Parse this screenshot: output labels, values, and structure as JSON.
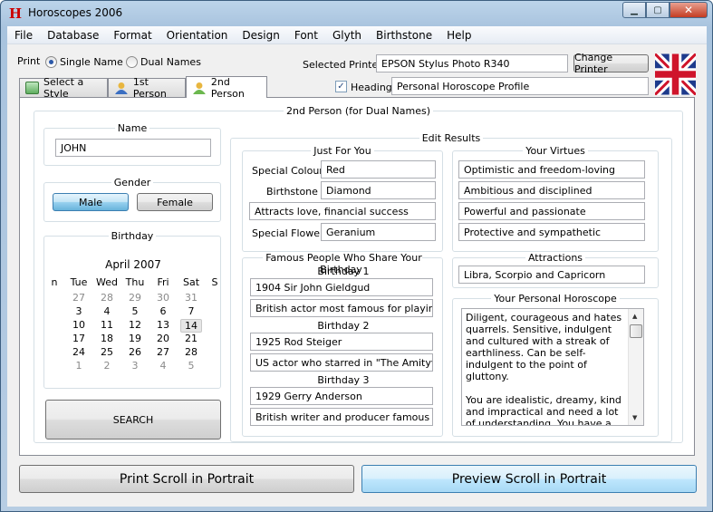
{
  "window": {
    "title": "Horoscopes 2006",
    "minimize": "▁",
    "maximize": "▢",
    "close": "✕"
  },
  "menu": [
    "File",
    "Database",
    "Format",
    "Orientation",
    "Design",
    "Font",
    "Glyth",
    "Birthstone",
    "Help"
  ],
  "print": {
    "label": "Print",
    "single": "Single Name",
    "dual": "Dual Names",
    "selected": "single"
  },
  "printer": {
    "label": "Selected Printer",
    "value": "EPSON Stylus Photo R340",
    "change_button": "Change Printer"
  },
  "heading": {
    "checked": true,
    "label": "Heading",
    "value": "Personal Horoscope Profile"
  },
  "tabs": [
    {
      "label": "Select a Style",
      "icon": "image-icon"
    },
    {
      "label": "1st Person",
      "icon": "person-icon"
    },
    {
      "label": "2nd Person",
      "icon": "person-icon"
    }
  ],
  "active_tab": 2,
  "panel_title": "2nd Person (for Dual Names)",
  "name": {
    "label": "Name",
    "value": "JOHN"
  },
  "gender": {
    "label": "Gender",
    "male": "Male",
    "female": "Female",
    "selected": "male"
  },
  "birthday": {
    "label": "Birthday",
    "month": "April 2007",
    "days": [
      "n",
      "Tue",
      "Wed",
      "Thu",
      "Fri",
      "Sat",
      "S"
    ],
    "weeks": [
      [
        "27",
        "28",
        "29",
        "30",
        "31"
      ],
      [
        "3",
        "4",
        "5",
        "6",
        "7"
      ],
      [
        "10",
        "11",
        "12",
        "13",
        "14"
      ],
      [
        "17",
        "18",
        "19",
        "20",
        "21"
      ],
      [
        "24",
        "25",
        "26",
        "27",
        "28"
      ],
      [
        "1",
        "2",
        "3",
        "4",
        "5"
      ]
    ],
    "selected": "14"
  },
  "search_button": "SEARCH",
  "edit_results": {
    "label": "Edit Results",
    "just_for_you": {
      "label": "Just For You",
      "colour_label": "Special Colour",
      "colour": "Red",
      "birthstone_label": "Birthstone",
      "birthstone": "Diamond",
      "attracts": "Attracts love, financial success",
      "flower_label": "Special Flower",
      "flower": "Geranium"
    },
    "virtues": {
      "label": "Your Virtues",
      "items": [
        "Optimistic and freedom-loving",
        "Ambitious and disciplined",
        "Powerful and passionate",
        "Protective and sympathetic"
      ]
    },
    "famous": {
      "label": "Famous People Who Share Your Birthday",
      "people": [
        {
          "label": "Birthday 1",
          "name": "1904 Sir John Gieldgud",
          "desc": "British actor most famous for playing \"Ha"
        },
        {
          "label": "Birthday 2",
          "name": "1925 Rod Steiger",
          "desc": "US actor who starred in \"The Amityville H"
        },
        {
          "label": "Birthday 3",
          "name": "1929 Gerry Anderson",
          "desc": "British writer and producer famous for \"T"
        }
      ]
    },
    "attractions": {
      "label": "Attractions",
      "value": "Libra, Scorpio and Capricorn"
    },
    "horoscope": {
      "label": "Your Personal Horoscope",
      "p1": "Diligent, courageous and hates quarrels. Sensitive, indulgent and cultured with a streak of earthliness. Can be self-indulgent to the point of gluttony.",
      "p2": "You are idealistic, dreamy, kind and impractical and need a lot of understanding. You have a"
    }
  },
  "print_button": "Print Scroll in Portrait",
  "preview_button": "Preview Scroll in Portrait",
  "colors": {
    "accent": "#2b58a8",
    "flag_blue": "#1d3a8c",
    "flag_red": "#cf142b"
  }
}
